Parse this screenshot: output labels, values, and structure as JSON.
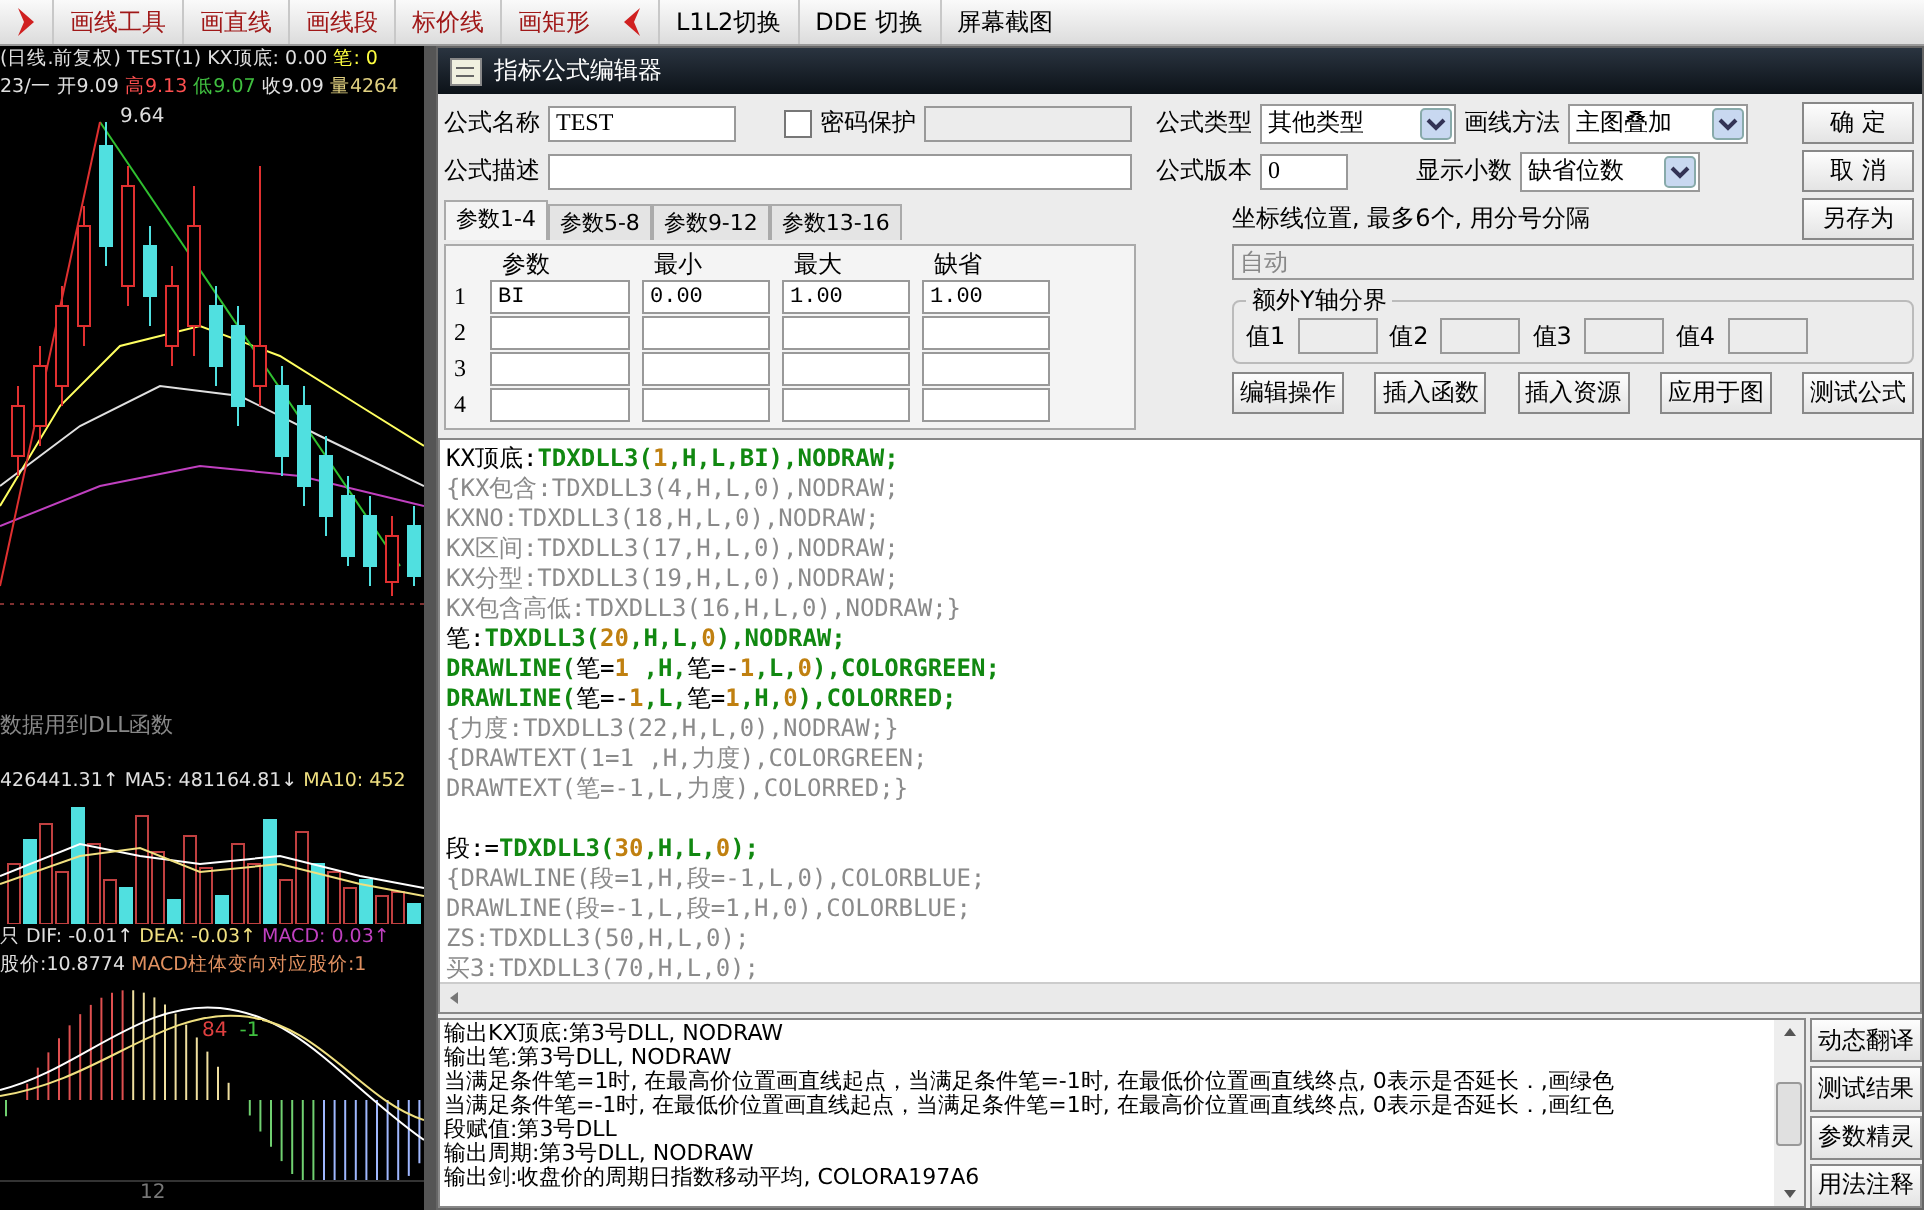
{
  "toolbar": {
    "left_items": [
      "画线工具",
      "画直线",
      "画线段",
      "标价线",
      "画矩形"
    ],
    "right_items": [
      "L1L2切换",
      "DDE 切换",
      "屏幕截图"
    ]
  },
  "chart": {
    "header": [
      [
        {
          "text": "(日线.前复权) TEST(1) KX顶底: 0.00",
          "color": "#e0e0e0"
        },
        {
          "text": "笔: 0",
          "color": "#ffff40"
        }
      ],
      [
        {
          "text": "23/一 开9.09",
          "color": "#e0e0e0"
        },
        {
          "text": "高9.13",
          "color": "#ff5050"
        },
        {
          "text": "低9.07",
          "color": "#40c040"
        },
        {
          "text": "收9.09",
          "color": "#e0e0e0"
        },
        {
          "text": "量4264",
          "color": "#e0d080"
        }
      ]
    ],
    "peak_label": "9.64",
    "note": "数据用到DLL函数",
    "volume_header": [
      {
        "text": "426441.31↑",
        "color": "#e0e0e0"
      },
      {
        "text": "MA5: 481164.81↓",
        "color": "#e0e0e0"
      },
      {
        "text": "MA10: 452",
        "color": "#f0e080"
      }
    ],
    "macd_header": [
      {
        "text": "只",
        "color": "#e0e0e0"
      },
      {
        "text": "DIF: -0.01↑",
        "color": "#e0e0e0"
      },
      {
        "text": "DEA: -0.03↑",
        "color": "#f0e080"
      },
      {
        "text": "MACD: 0.03↑",
        "color": "#c040c0"
      }
    ],
    "price_line": [
      {
        "text": "股价:10.8774",
        "color": "#e0e0e0"
      },
      {
        "text": "MACD柱体变向对应股价:1",
        "color": "#e09060"
      }
    ],
    "macd_marks": [
      {
        "text": "84",
        "color": "#e04040"
      },
      {
        "text": "-1",
        "color": "#40c040"
      }
    ],
    "x_label": "12"
  },
  "dialog": {
    "title": "指标公式编辑器",
    "name": {
      "label": "公式名称",
      "value": "TEST"
    },
    "password": {
      "label": "密码保护",
      "checked": false
    },
    "description": {
      "label": "公式描述"
    },
    "type": {
      "label": "公式类型",
      "value": "其他类型"
    },
    "version": {
      "label": "公式版本",
      "value": "0"
    },
    "draw_method": {
      "label": "画线方法",
      "value": "主图叠加"
    },
    "decimals": {
      "label": "显示小数",
      "value": "缺省位数"
    },
    "side_buttons": [
      "确 定",
      "取 消",
      "另存为"
    ],
    "tabs": [
      {
        "label": "参数1-4",
        "selected": true
      },
      {
        "label": "参数5-8",
        "selected": false
      },
      {
        "label": "参数9-12",
        "selected": false
      },
      {
        "label": "参数13-16",
        "selected": false
      }
    ],
    "params": {
      "columns": [
        "参数",
        "最小",
        "最大",
        "缺省"
      ],
      "rows": [
        {
          "index": "1",
          "cells": [
            "BI",
            "0.00",
            "1.00",
            "1.00"
          ]
        },
        {
          "index": "2"
        },
        {
          "index": "3"
        },
        {
          "index": "4"
        }
      ]
    },
    "axis_lines": {
      "label": "坐标线位置, 最多6个, 用分号分隔",
      "placeholder": "自动"
    },
    "y_bounds": {
      "title": "额外Y轴分界",
      "fields": [
        "值1",
        "值2",
        "值3",
        "值4"
      ]
    },
    "action_buttons": [
      "编辑操作",
      "插入函数",
      "插入资源",
      "应用于图",
      "测试公式"
    ],
    "code_lines": [
      {
        "kind": "code",
        "tokens": [
          {
            "kind": "plain",
            "text": "KX顶底:"
          },
          {
            "kind": "func",
            "text": "TDXDLL3("
          },
          {
            "kind": "num",
            "text": "1"
          },
          {
            "kind": "func",
            "text": ",H,L,BI),NODRAW;"
          }
        ]
      },
      {
        "kind": "comment",
        "text": "{KX包含:TDXDLL3(4,H,L,0),NODRAW;"
      },
      {
        "kind": "comment",
        "text": "KXNO:TDXDLL3(18,H,L,0),NODRAW;"
      },
      {
        "kind": "comment",
        "text": "KX区间:TDXDLL3(17,H,L,0),NODRAW;"
      },
      {
        "kind": "comment",
        "text": "KX分型:TDXDLL3(19,H,L,0),NODRAW;"
      },
      {
        "kind": "comment",
        "text": "KX包含高低:TDXDLL3(16,H,L,0),NODRAW;}"
      },
      {
        "kind": "code",
        "tokens": [
          {
            "kind": "plain",
            "text": "笔:"
          },
          {
            "kind": "func",
            "text": "TDXDLL3("
          },
          {
            "kind": "num",
            "text": "20"
          },
          {
            "kind": "func",
            "text": ",H,L,"
          },
          {
            "kind": "num",
            "text": "0"
          },
          {
            "kind": "func",
            "text": "),NODRAW;"
          }
        ]
      },
      {
        "kind": "code",
        "tokens": [
          {
            "kind": "func",
            "text": "DRAWLINE("
          },
          {
            "kind": "plain",
            "text": "笔="
          },
          {
            "kind": "num",
            "text": "1"
          },
          {
            "kind": "func",
            "text": " ,H,"
          },
          {
            "kind": "plain",
            "text": "笔=-"
          },
          {
            "kind": "num",
            "text": "1"
          },
          {
            "kind": "func",
            "text": ",L,"
          },
          {
            "kind": "num",
            "text": "0"
          },
          {
            "kind": "func",
            "text": "),COLORGREEN;"
          }
        ]
      },
      {
        "kind": "code",
        "tokens": [
          {
            "kind": "func",
            "text": "DRAWLINE("
          },
          {
            "kind": "plain",
            "text": "笔=-"
          },
          {
            "kind": "num",
            "text": "1"
          },
          {
            "kind": "func",
            "text": ",L,"
          },
          {
            "kind": "plain",
            "text": "笔="
          },
          {
            "kind": "num",
            "text": "1"
          },
          {
            "kind": "func",
            "text": ",H,"
          },
          {
            "kind": "num",
            "text": "0"
          },
          {
            "kind": "func",
            "text": "),COLORRED;"
          }
        ]
      },
      {
        "kind": "comment",
        "text": "{力度:TDXDLL3(22,H,L,0),NODRAW;}"
      },
      {
        "kind": "comment",
        "text": "{DRAWTEXT(1=1 ,H,力度),COLORGREEN;"
      },
      {
        "kind": "comment",
        "text": "DRAWTEXT(笔=-1,L,力度),COLORRED;}"
      },
      {
        "kind": "blank"
      },
      {
        "kind": "code",
        "tokens": [
          {
            "kind": "plain",
            "text": "段:="
          },
          {
            "kind": "func",
            "text": "TDXDLL3("
          },
          {
            "kind": "num",
            "text": "30"
          },
          {
            "kind": "func",
            "text": ",H,L,"
          },
          {
            "kind": "num",
            "text": "0"
          },
          {
            "kind": "func",
            "text": ");"
          }
        ]
      },
      {
        "kind": "comment",
        "text": "{DRAWLINE(段=1,H,段=-1,L,0),COLORBLUE;"
      },
      {
        "kind": "comment",
        "text": "DRAWLINE(段=-1,L,段=1,H,0),COLORBLUE;"
      },
      {
        "kind": "comment",
        "text": "ZS:TDXDLL3(50,H,L,0);"
      },
      {
        "kind": "comment",
        "text": "买3:TDXDLL3(70,H,L,0);"
      }
    ],
    "output_lines": [
      "输出KX顶底:第3号DLL, NODRAW",
      "输出笔:第3号DLL, NODRAW",
      "当满足条件笔=1时, 在最高价位置画直线起点，当满足条件笔=-1时, 在最低价位置画直线终点, 0表示是否延长．,画绿色",
      "当满足条件笔=-1时, 在最低价位置画直线起点，当满足条件笔=1时, 在最高价位置画直线终点, 0表示是否延长．,画红色",
      "段赋值:第3号DLL",
      "输出周期:第3号DLL, NODRAW",
      "输出剑:收盘价的周期日指数移动平均, COLORA197A6"
    ],
    "output_buttons": [
      "动态翻译",
      "测试结果",
      "参数精灵",
      "用法注释"
    ]
  }
}
